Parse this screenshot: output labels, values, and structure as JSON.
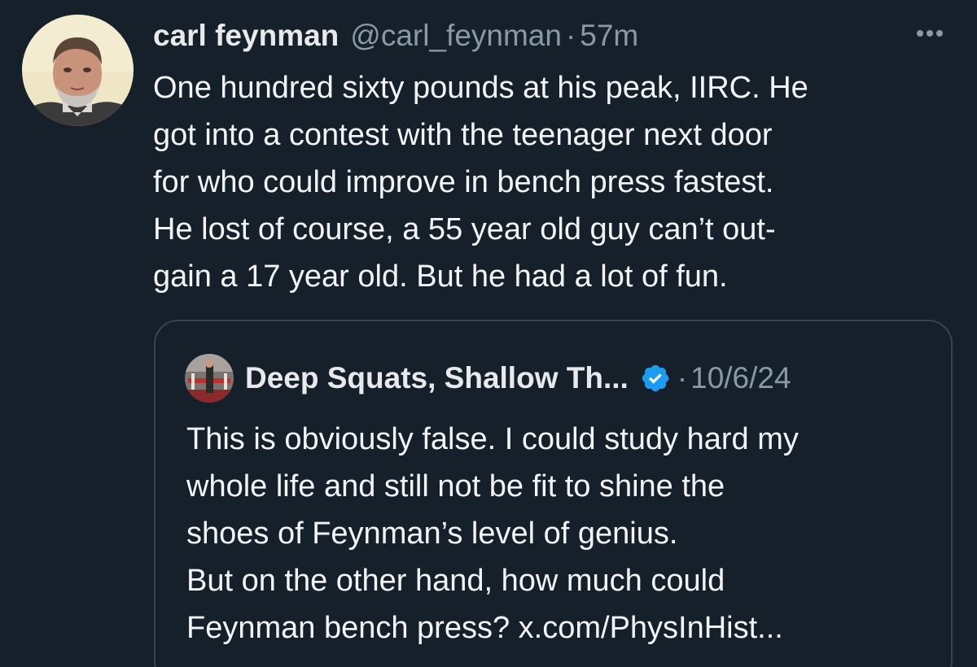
{
  "tweet": {
    "display_name": "carl feynman",
    "handle": "@carl_feynman",
    "separator": "·",
    "time": "57m",
    "more_icon": "more-dots-icon",
    "body_lines": [
      "One hundred sixty pounds at his peak, IIRC.  He",
      "got into a contest with the teenager next door",
      "for who could improve in bench press fastest.",
      "He lost of course, a 55 year old guy can’t out-",
      "gain a 17 year old.  But he had a lot of fun."
    ]
  },
  "quoted": {
    "display_name": "Deep Squats, Shallow Th...",
    "verified_icon": "verified-badge-icon",
    "separator": "·",
    "time": "10/6/24",
    "body_lines": [
      "This is obviously false. I could study hard my",
      "whole life and still not be fit to shine the",
      "shoes of Feynman’s level of genius.",
      "But on the other hand, how much could",
      "Feynman bench press? x.com/PhysInHist..."
    ]
  },
  "colors": {
    "background": "#15202b",
    "text": "#e7e9ea",
    "secondary_text": "#8b98a5",
    "border": "#38444d",
    "verified": "#1d9bf0"
  }
}
